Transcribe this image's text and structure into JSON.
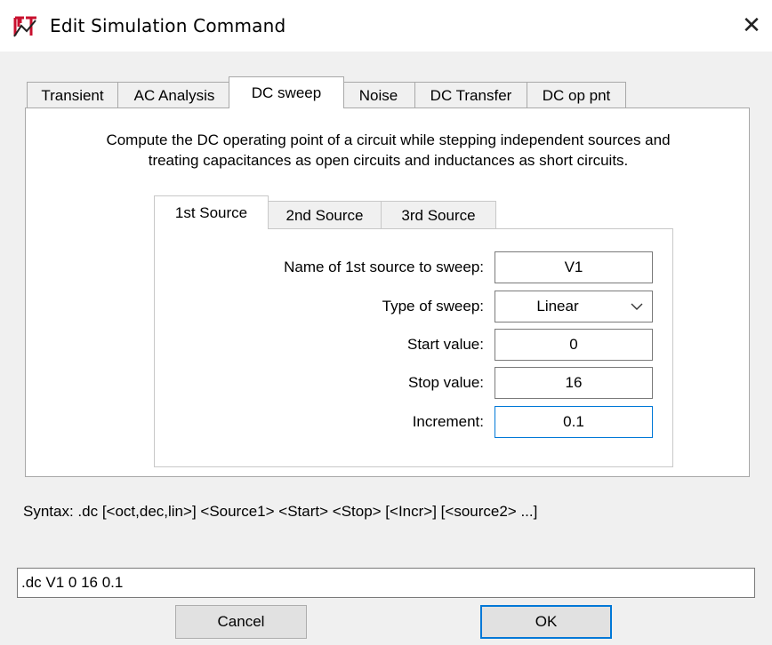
{
  "window": {
    "title": "Edit Simulation Command",
    "close_glyph": "✕",
    "app_icon": "ltspice-logo-icon"
  },
  "tabs": [
    {
      "label": "Transient",
      "active": false
    },
    {
      "label": "AC Analysis",
      "active": false
    },
    {
      "label": "DC sweep",
      "active": true
    },
    {
      "label": "Noise",
      "active": false
    },
    {
      "label": "DC Transfer",
      "active": false
    },
    {
      "label": "DC op pnt",
      "active": false
    }
  ],
  "dc_sweep": {
    "description_line1": "Compute the DC operating point of a circuit while stepping independent sources and",
    "description_line2": "treating capacitances as open circuits and inductances as short circuits.",
    "source_tabs": [
      {
        "label": "1st Source",
        "active": true
      },
      {
        "label": "2nd Source",
        "active": false
      },
      {
        "label": "3rd Source",
        "active": false
      }
    ],
    "form": {
      "source_name_label": "Name of 1st source to sweep:",
      "source_name_value": "V1",
      "sweep_type_label": "Type of sweep:",
      "sweep_type_value": "Linear",
      "start_label": "Start value:",
      "start_value": "0",
      "stop_label": "Stop value:",
      "stop_value": "16",
      "increment_label": "Increment:",
      "increment_value": "0.1"
    }
  },
  "syntax": "Syntax:  .dc [<oct,dec,lin>] <Source1> <Start> <Stop> [<Incr>] [<source2> ...]",
  "command": ".dc V1 0 16 0.1",
  "buttons": {
    "cancel": "Cancel",
    "ok": "OK"
  },
  "colors": {
    "focus_accent": "#0078d7",
    "logo_red": "#c8102e"
  }
}
